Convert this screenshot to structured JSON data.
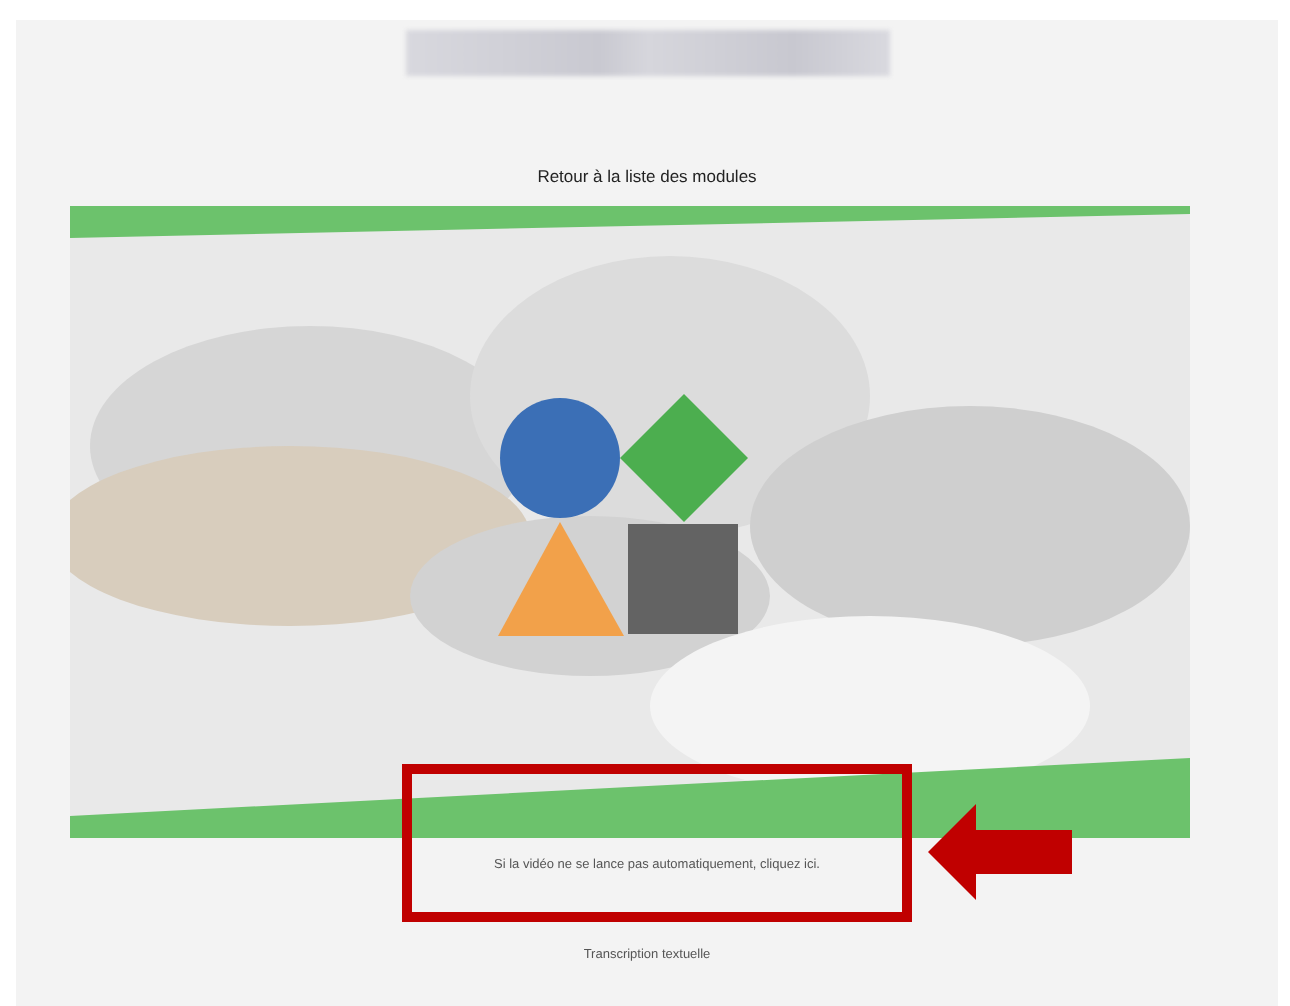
{
  "back_link": "Retour à la liste des modules",
  "video": {
    "fallback_text": "Si la vidéo ne se lance pas automatiquement, cliquez ici.",
    "highlighted": true
  },
  "transcript_link": "Transcription textuelle"
}
